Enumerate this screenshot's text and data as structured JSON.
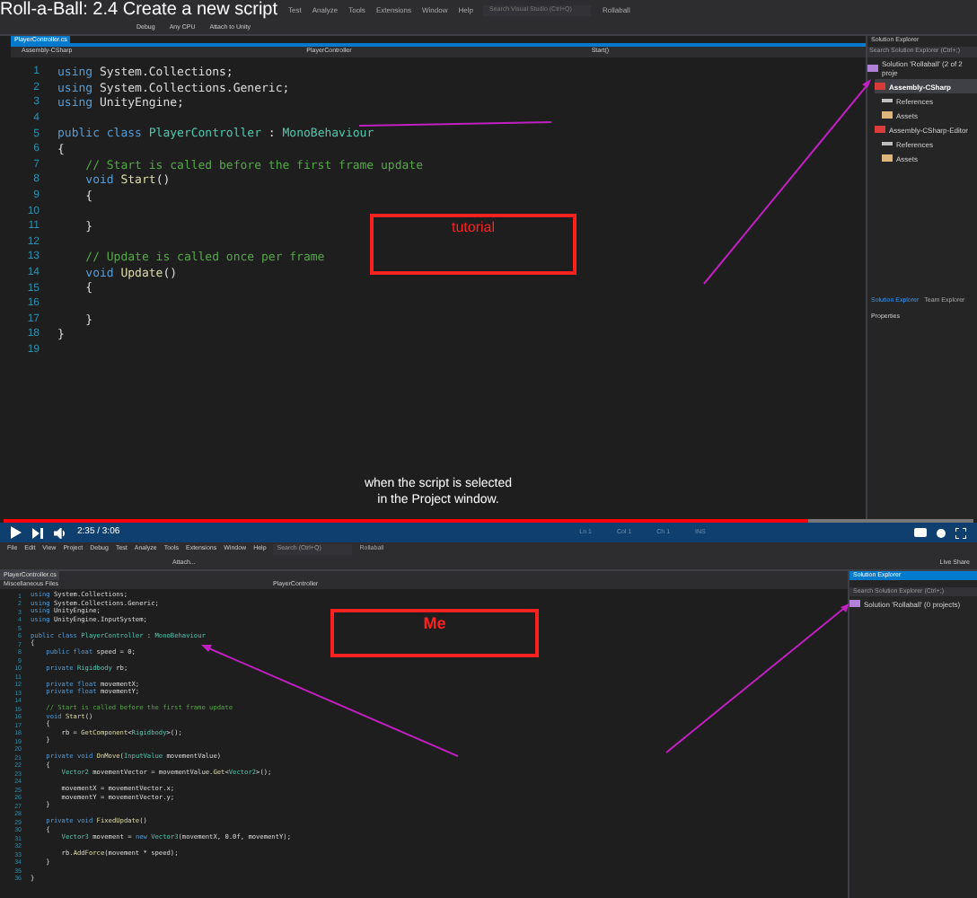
{
  "video": {
    "title": "Roll-a-Ball: 2.4 Create a new script",
    "subtitle_lines": [
      "when the script is selected",
      "in the Project window."
    ],
    "time": "2:35 / 3:06",
    "level": 0.83
  },
  "tutorial_ide": {
    "menu": [
      "Test",
      "Analyze",
      "Tools",
      "Extensions",
      "Window",
      "Help"
    ],
    "search": {
      "placeholder": "Search Visual Studio (Ctrl+Q)"
    },
    "solution_name": "Rollaball",
    "toolbar": [
      "Debug",
      "Any CPU",
      "Attach to Unity"
    ],
    "tab": "PlayerController.cs",
    "nav": [
      "Assembly-CSharp",
      "PlayerController",
      "Start()"
    ],
    "code": [
      {
        "n": "1",
        "s": [
          {
            "kind": "kw",
            "text": "using"
          },
          {
            "kind": "plain",
            "text": " System.Collections;"
          }
        ]
      },
      {
        "n": "2",
        "s": [
          {
            "kind": "kw",
            "text": "using"
          },
          {
            "kind": "plain",
            "text": " System.Collections.Generic;"
          }
        ]
      },
      {
        "n": "3",
        "s": [
          {
            "kind": "kw",
            "text": "using"
          },
          {
            "kind": "plain",
            "text": " UnityEngine;"
          }
        ]
      },
      {
        "n": "4"
      },
      {
        "n": "5",
        "s": [
          {
            "kind": "kw",
            "text": "public class "
          },
          {
            "kind": "type",
            "text": "PlayerController"
          },
          {
            "kind": "plain",
            "text": " : "
          },
          {
            "kind": "type",
            "text": "MonoBehaviour"
          }
        ]
      },
      {
        "n": "6",
        "s": [
          {
            "kind": "plain",
            "text": "{"
          }
        ]
      },
      {
        "n": "7",
        "s": [
          {
            "kind": "comment",
            "text": "    // Start is called before the first frame update"
          }
        ]
      },
      {
        "n": "8",
        "s": [
          {
            "kind": "kw",
            "text": "    void "
          },
          {
            "kind": "fn",
            "text": "Start"
          },
          {
            "kind": "plain",
            "text": "()"
          }
        ]
      },
      {
        "n": "9",
        "s": [
          {
            "kind": "plain",
            "text": "    {"
          }
        ]
      },
      {
        "n": "10"
      },
      {
        "n": "11",
        "s": [
          {
            "kind": "plain",
            "text": "    }"
          }
        ]
      },
      {
        "n": "12"
      },
      {
        "n": "13",
        "s": [
          {
            "kind": "comment",
            "text": "    // Update is called once per frame"
          }
        ]
      },
      {
        "n": "14",
        "s": [
          {
            "kind": "kw",
            "text": "    void "
          },
          {
            "kind": "fn",
            "text": "Update"
          },
          {
            "kind": "plain",
            "text": "()"
          }
        ]
      },
      {
        "n": "15",
        "s": [
          {
            "kind": "plain",
            "text": "    {"
          }
        ]
      },
      {
        "n": "16"
      },
      {
        "n": "17",
        "s": [
          {
            "kind": "plain",
            "text": "    }"
          }
        ]
      },
      {
        "n": "18",
        "s": [
          {
            "kind": "plain",
            "text": "}"
          }
        ]
      },
      {
        "n": "19"
      }
    ],
    "solution_explorer": {
      "title": "Solution Explorer",
      "search": {
        "placeholder": "Search Solution Explorer (Ctrl+;)"
      },
      "tree": [
        {
          "label": "Solution 'Rollaball' (2 of 2 proje",
          "kind": "solution",
          "selected": false,
          "children": [
            {
              "label": "Assembly-CSharp",
              "kind": "project",
              "selected": true,
              "children": [
                {
                  "label": "References",
                  "kind": "references",
                  "selected": false
                },
                {
                  "label": "Assets",
                  "kind": "folder",
                  "selected": false
                }
              ]
            },
            {
              "label": "Assembly-CSharp-Editor",
              "kind": "project",
              "selected": false,
              "children": [
                {
                  "label": "References",
                  "kind": "references",
                  "selected": false
                },
                {
                  "label": "Assets",
                  "kind": "folder",
                  "selected": false
                }
              ]
            }
          ]
        }
      ],
      "tabs": [
        {
          "label": "Solution Explorer",
          "selected": true
        },
        {
          "label": "Team Explorer",
          "selected": false
        }
      ],
      "properties": {
        "title": "Properties"
      }
    },
    "status": [
      "Ln 1",
      "Col 1",
      "Ch 1",
      "INS"
    ],
    "annotation": {
      "label": "tutorial"
    }
  },
  "my_ide": {
    "menu": [
      "File",
      "Edit",
      "View",
      "Project",
      "Debug",
      "Test",
      "Analyze",
      "Tools",
      "Extensions",
      "Window",
      "Help"
    ],
    "search": {
      "placeholder": "Search (Ctrl+Q)"
    },
    "solution_name": "Rollaball",
    "toolbar": [
      "Attach..."
    ],
    "live_share": "Live Share",
    "tab": "PlayerController.cs",
    "nav": [
      "Miscellaneous Files",
      "PlayerController"
    ],
    "code": [
      {
        "n": "1",
        "s": [
          {
            "kind": "kw",
            "text": "using"
          },
          {
            "kind": "plain",
            "text": " System.Collections;"
          }
        ]
      },
      {
        "n": "2",
        "s": [
          {
            "kind": "kw",
            "text": "using"
          },
          {
            "kind": "plain",
            "text": " System.Collections.Generic;"
          }
        ]
      },
      {
        "n": "3",
        "s": [
          {
            "kind": "kw",
            "text": "using"
          },
          {
            "kind": "plain",
            "text": " UnityEngine;"
          }
        ]
      },
      {
        "n": "4",
        "s": [
          {
            "kind": "kw",
            "text": "using"
          },
          {
            "kind": "plain",
            "text": " UnityEngine.InputSystem;"
          }
        ]
      },
      {
        "n": "5"
      },
      {
        "n": "6",
        "s": [
          {
            "kind": "kw",
            "text": "public class "
          },
          {
            "kind": "type",
            "text": "PlayerController"
          },
          {
            "kind": "plain",
            "text": " : "
          },
          {
            "kind": "type",
            "text": "MonoBehaviour"
          }
        ]
      },
      {
        "n": "7",
        "s": [
          {
            "kind": "plain",
            "text": "{"
          }
        ]
      },
      {
        "n": "8",
        "s": [
          {
            "kind": "kw",
            "text": "    public float "
          },
          {
            "kind": "plain",
            "text": "speed = 0;"
          }
        ]
      },
      {
        "n": "9"
      },
      {
        "n": "10",
        "s": [
          {
            "kind": "kw",
            "text": "    private "
          },
          {
            "kind": "type",
            "text": "Rigidbody"
          },
          {
            "kind": "plain",
            "text": " rb;"
          }
        ]
      },
      {
        "n": "11"
      },
      {
        "n": "12",
        "s": [
          {
            "kind": "kw",
            "text": "    private float "
          },
          {
            "kind": "plain",
            "text": "movementX;"
          }
        ]
      },
      {
        "n": "13",
        "s": [
          {
            "kind": "kw",
            "text": "    private float "
          },
          {
            "kind": "plain",
            "text": "movementY;"
          }
        ]
      },
      {
        "n": "14"
      },
      {
        "n": "15",
        "s": [
          {
            "kind": "comment",
            "text": "    // Start is called before the first frame update"
          }
        ]
      },
      {
        "n": "16",
        "s": [
          {
            "kind": "kw",
            "text": "    void "
          },
          {
            "kind": "fn",
            "text": "Start"
          },
          {
            "kind": "plain",
            "text": "()"
          }
        ]
      },
      {
        "n": "17",
        "s": [
          {
            "kind": "plain",
            "text": "    {"
          }
        ]
      },
      {
        "n": "18",
        "s": [
          {
            "kind": "plain",
            "text": "        rb = "
          },
          {
            "kind": "fn",
            "text": "GetComponent"
          },
          {
            "kind": "plain",
            "text": "<"
          },
          {
            "kind": "type",
            "text": "Rigidbody"
          },
          {
            "kind": "plain",
            "text": ">();"
          }
        ]
      },
      {
        "n": "19",
        "s": [
          {
            "kind": "plain",
            "text": "    }"
          }
        ]
      },
      {
        "n": "20"
      },
      {
        "n": "21",
        "s": [
          {
            "kind": "kw",
            "text": "    private void "
          },
          {
            "kind": "fn",
            "text": "OnMove"
          },
          {
            "kind": "plain",
            "text": "("
          },
          {
            "kind": "type",
            "text": "InputValue"
          },
          {
            "kind": "plain",
            "text": " movementValue)"
          }
        ]
      },
      {
        "n": "22",
        "s": [
          {
            "kind": "plain",
            "text": "    {"
          }
        ]
      },
      {
        "n": "23",
        "s": [
          {
            "kind": "type",
            "text": "        Vector2"
          },
          {
            "kind": "plain",
            "text": " movementVector = movementValue."
          },
          {
            "kind": "fn",
            "text": "Get"
          },
          {
            "kind": "plain",
            "text": "<"
          },
          {
            "kind": "type",
            "text": "Vector2"
          },
          {
            "kind": "plain",
            "text": ">();"
          }
        ]
      },
      {
        "n": "24"
      },
      {
        "n": "25",
        "s": [
          {
            "kind": "plain",
            "text": "        movementX = movementVector.x;"
          }
        ]
      },
      {
        "n": "26",
        "s": [
          {
            "kind": "plain",
            "text": "        movementY = movementVector.y;"
          }
        ]
      },
      {
        "n": "27",
        "s": [
          {
            "kind": "plain",
            "text": "    }"
          }
        ]
      },
      {
        "n": "28"
      },
      {
        "n": "29",
        "s": [
          {
            "kind": "kw",
            "text": "    private void "
          },
          {
            "kind": "fn",
            "text": "FixedUpdate"
          },
          {
            "kind": "plain",
            "text": "()"
          }
        ]
      },
      {
        "n": "30",
        "s": [
          {
            "kind": "plain",
            "text": "    {"
          }
        ]
      },
      {
        "n": "31",
        "s": [
          {
            "kind": "type",
            "text": "        Vector3"
          },
          {
            "kind": "plain",
            "text": " movement = "
          },
          {
            "kind": "kw",
            "text": "new "
          },
          {
            "kind": "type",
            "text": "Vector3"
          },
          {
            "kind": "plain",
            "text": "(movementX, 0.0f, movementY);"
          }
        ]
      },
      {
        "n": "32"
      },
      {
        "n": "33",
        "s": [
          {
            "kind": "plain",
            "text": "        rb."
          },
          {
            "kind": "fn",
            "text": "AddForce"
          },
          {
            "kind": "plain",
            "text": "(movement * speed);"
          }
        ]
      },
      {
        "n": "34",
        "s": [
          {
            "kind": "plain",
            "text": "    }"
          }
        ]
      },
      {
        "n": "35"
      },
      {
        "n": "36",
        "s": [
          {
            "kind": "plain",
            "text": "}"
          }
        ]
      }
    ],
    "solution_explorer": {
      "title": "Solution Explorer",
      "search": {
        "placeholder": "Search Solution Explorer (Ctrl+;)"
      },
      "tree": [
        {
          "label": "Solution 'Rollaball' (0 projects)",
          "kind": "solution",
          "selected": false
        }
      ]
    },
    "annotation": {
      "label": "Me"
    }
  }
}
